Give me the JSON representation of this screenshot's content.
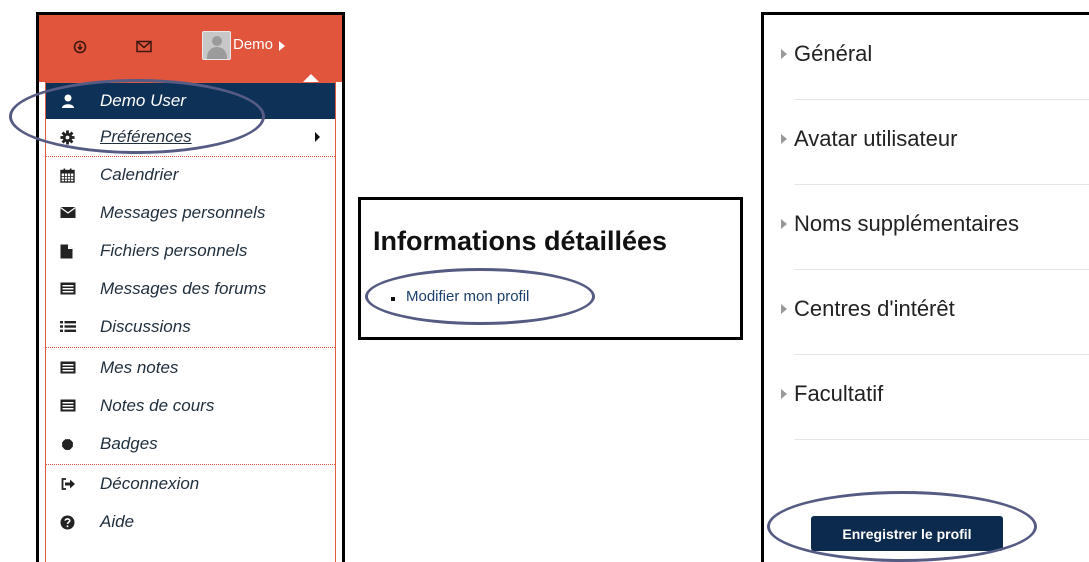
{
  "navbar": {
    "user_name": "Demo",
    "icons": [
      "download-icon",
      "envelope-icon",
      "avatar"
    ],
    "color": "#e0553b"
  },
  "user_menu": {
    "items": [
      {
        "label": "Demo User",
        "icon": "user-icon"
      },
      {
        "label": "Préférences",
        "icon": "gear-icon"
      },
      {
        "label": "Calendrier",
        "icon": "calendar-icon"
      },
      {
        "label": "Messages personnels",
        "icon": "envelope-icon"
      },
      {
        "label": "Fichiers personnels",
        "icon": "file-icon"
      },
      {
        "label": "Messages des forums",
        "icon": "list-alt-icon"
      },
      {
        "label": "Discussions",
        "icon": "list-icon"
      },
      {
        "label": "Mes notes",
        "icon": "list-alt-icon"
      },
      {
        "label": "Notes de cours",
        "icon": "list-alt-icon"
      },
      {
        "label": "Badges",
        "icon": "badge-icon"
      },
      {
        "label": "Déconnexion",
        "icon": "sign-out-icon"
      },
      {
        "label": "Aide",
        "icon": "question-icon"
      }
    ],
    "active_color": "#0d3157"
  },
  "details": {
    "title": "Informations détaillées",
    "link": "Modifier mon profil"
  },
  "profile_form": {
    "sections": [
      "Général",
      "Avatar utilisateur",
      "Noms supplémentaires",
      "Centres d'intérêt",
      "Facultatif"
    ],
    "save_button": "Enregistrer le profil",
    "button_color": "#0b2a4d"
  },
  "annotation_color": "#565b84"
}
